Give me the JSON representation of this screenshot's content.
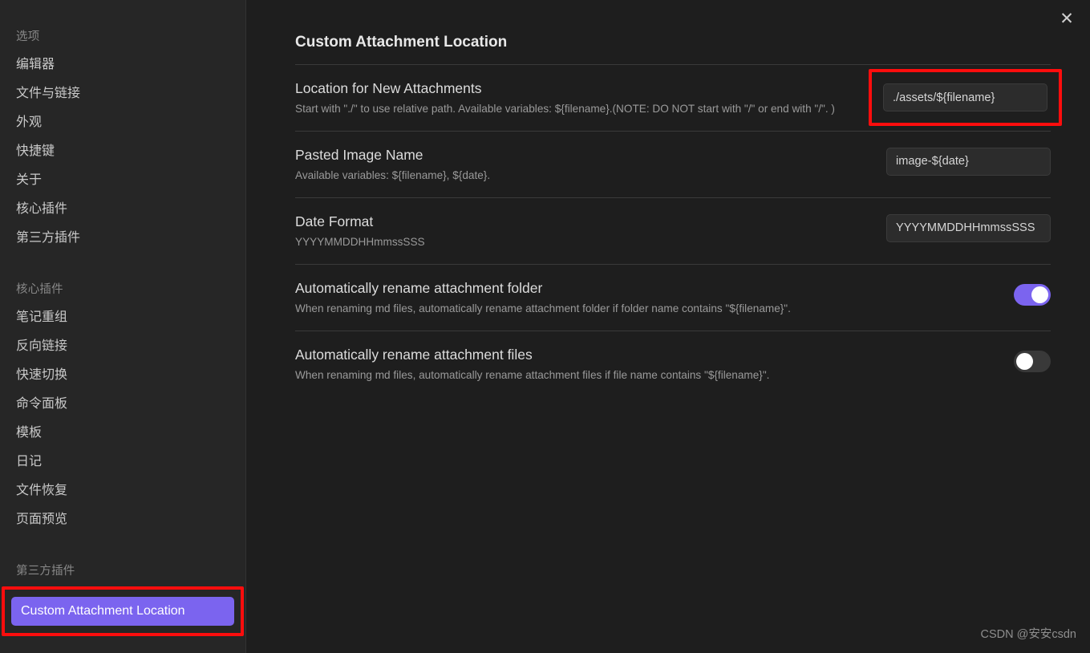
{
  "sidebar": {
    "groups": [
      {
        "header": "选项",
        "items": [
          {
            "label": "编辑器"
          },
          {
            "label": "文件与链接"
          },
          {
            "label": "外观"
          },
          {
            "label": "快捷键"
          },
          {
            "label": "关于"
          },
          {
            "label": "核心插件"
          },
          {
            "label": "第三方插件"
          }
        ]
      },
      {
        "header": "核心插件",
        "items": [
          {
            "label": "笔记重组"
          },
          {
            "label": "反向链接"
          },
          {
            "label": "快速切换"
          },
          {
            "label": "命令面板"
          },
          {
            "label": "模板"
          },
          {
            "label": "日记"
          },
          {
            "label": "文件恢复"
          },
          {
            "label": "页面预览"
          }
        ]
      },
      {
        "header": "第三方插件",
        "items": [
          {
            "label": "Custom Attachment Location",
            "active": true,
            "annotated": true
          }
        ]
      }
    ]
  },
  "header": {
    "title": "Custom Attachment Location",
    "close_icon": "close-icon"
  },
  "settings": [
    {
      "name": "Location for New Attachments",
      "desc": "Start with \"./\" to use relative path. Available variables: ${filename}.(NOTE: DO NOT start with \"/\" or end with \"/\". )",
      "control": "text",
      "value": "./assets/${filename}",
      "annotated": true
    },
    {
      "name": "Pasted Image Name",
      "desc": "Available variables: ${filename}, ${date}.",
      "control": "text",
      "value": "image-${date}",
      "annotated": false
    },
    {
      "name": "Date Format",
      "desc": "YYYYMMDDHHmmssSSS",
      "control": "text",
      "value": "YYYYMMDDHHmmssSSS",
      "annotated": false
    },
    {
      "name": "Automatically rename attachment folder",
      "desc": "When renaming md files, automatically rename attachment folder if folder name contains \"${filename}\".",
      "control": "toggle",
      "value": "on",
      "annotated": false
    },
    {
      "name": "Automatically rename attachment files",
      "desc": "When renaming md files, automatically rename attachment files if file name contains \"${filename}\".",
      "control": "toggle",
      "value": "off",
      "annotated": false
    }
  ],
  "watermark": "CSDN @安安csdn",
  "colors": {
    "accent": "#7b64ef",
    "annotation": "#fd0d0d",
    "sidebar_bg": "#262626",
    "main_bg": "#1e1e1e"
  }
}
